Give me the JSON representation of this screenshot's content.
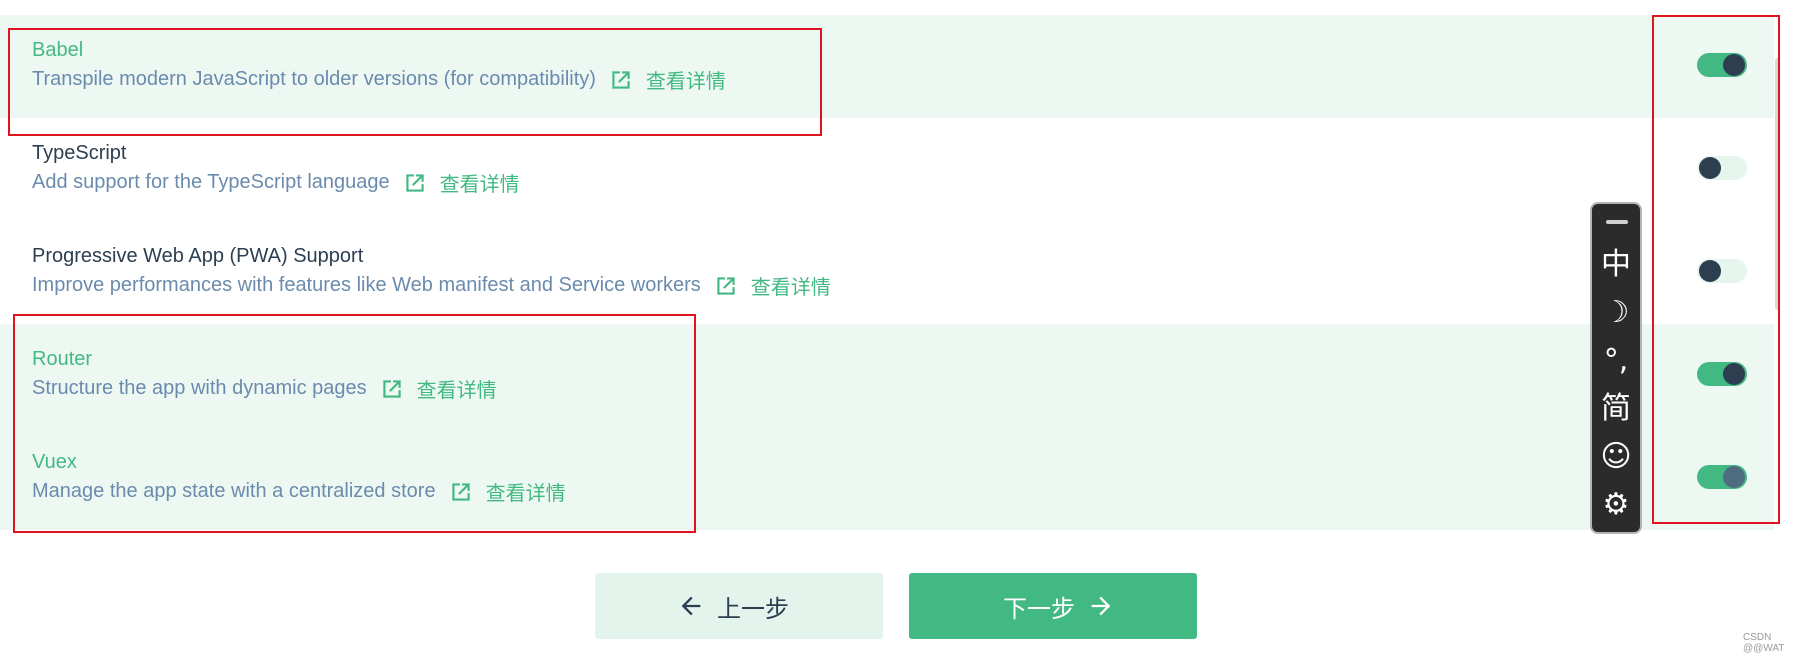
{
  "features": [
    {
      "name": "Babel",
      "description": "Transpile modern JavaScript to older versions (for compatibility)",
      "link_text": "查看详情",
      "enabled": true
    },
    {
      "name": "TypeScript",
      "description": "Add support for the TypeScript language",
      "link_text": "查看详情",
      "enabled": false
    },
    {
      "name": "Progressive Web App (PWA) Support",
      "description": "Improve performances with features like Web manifest and Service workers",
      "link_text": "查看详情",
      "enabled": false
    },
    {
      "name": "Router",
      "description": "Structure the app with dynamic pages",
      "link_text": "查看详情",
      "enabled": true
    },
    {
      "name": "Vuex",
      "description": "Manage the app state with a centralized store",
      "link_text": "查看详情",
      "enabled": true
    }
  ],
  "ime_toolbar": [
    "中",
    "☽",
    "°,",
    "简",
    "☺",
    "⚙"
  ],
  "buttons": {
    "prev_label": "上一步",
    "next_label": "下一步"
  },
  "watermark": "CSDN @@WAT",
  "colors": {
    "accent": "#42b983",
    "text": "#2c3e50",
    "description": "#6a8bad",
    "selected_bg": "#eef8f3",
    "annotation": "#e0141e"
  }
}
